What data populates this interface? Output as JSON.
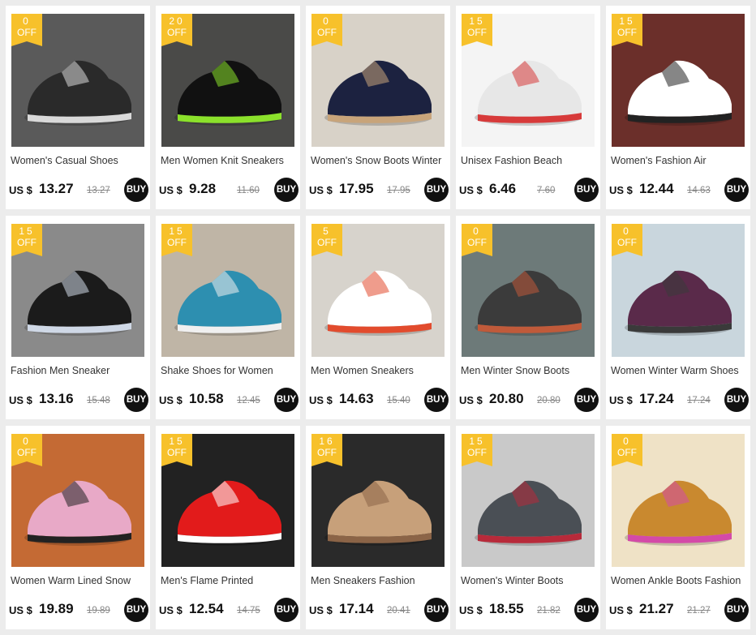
{
  "products": [
    {
      "title": "Women's Casual Shoes",
      "discount": "0",
      "off": "OFF",
      "currency": "US $",
      "price": "13.27",
      "original": "13.27",
      "buy": "BUY",
      "palette": [
        "#5a5a5a",
        "#2a2a2a",
        "#d9d9d9"
      ]
    },
    {
      "title": "Men Women Knit Sneakers",
      "discount": "20",
      "off": "OFF",
      "currency": "US $",
      "price": "9.28",
      "original": "11.60",
      "buy": "BUY",
      "palette": [
        "#4a4a48",
        "#111111",
        "#8be12b"
      ]
    },
    {
      "title": "Women's Snow Boots Winter",
      "discount": "0",
      "off": "OFF",
      "currency": "US $",
      "price": "17.95",
      "original": "17.95",
      "buy": "BUY",
      "palette": [
        "#d8d2c8",
        "#1c2240",
        "#c8a47a"
      ]
    },
    {
      "title": "Unisex Fashion Beach",
      "discount": "15",
      "off": "OFF",
      "currency": "US $",
      "price": "6.46",
      "original": "7.60",
      "buy": "BUY",
      "palette": [
        "#f4f4f4",
        "#e7e7e7",
        "#d73a3a"
      ]
    },
    {
      "title": "Women's Fashion Air",
      "discount": "15",
      "off": "OFF",
      "currency": "US $",
      "price": "12.44",
      "original": "14.63",
      "buy": "BUY",
      "palette": [
        "#6b2f2a",
        "#ffffff",
        "#222222"
      ]
    },
    {
      "title": "Fashion Men Sneaker",
      "discount": "15",
      "off": "OFF",
      "currency": "US $",
      "price": "13.16",
      "original": "15.48",
      "buy": "BUY",
      "palette": [
        "#8a8a8a",
        "#1b1b1b",
        "#cfd8e6"
      ]
    },
    {
      "title": "Shake Shoes for Women",
      "discount": "15",
      "off": "OFF",
      "currency": "US $",
      "price": "10.58",
      "original": "12.45",
      "buy": "BUY",
      "palette": [
        "#bfb5a6",
        "#2d8fb0",
        "#f0f0f0"
      ]
    },
    {
      "title": "Men Women Sneakers",
      "discount": "5",
      "off": "OFF",
      "currency": "US $",
      "price": "14.63",
      "original": "15.40",
      "buy": "BUY",
      "palette": [
        "#d7d3cc",
        "#ffffff",
        "#e24b2d"
      ]
    },
    {
      "title": "Men Winter Snow Boots",
      "discount": "0",
      "off": "OFF",
      "currency": "US $",
      "price": "20.80",
      "original": "20.80",
      "buy": "BUY",
      "palette": [
        "#6d7a79",
        "#3b3b3b",
        "#c05a3a"
      ]
    },
    {
      "title": "Women Winter Warm Shoes",
      "discount": "0",
      "off": "OFF",
      "currency": "US $",
      "price": "17.24",
      "original": "17.24",
      "buy": "BUY",
      "palette": [
        "#c9d6dd",
        "#5a2a4a",
        "#3a3a3a"
      ]
    },
    {
      "title": "Women Warm Lined Snow",
      "discount": "0",
      "off": "OFF",
      "currency": "US $",
      "price": "19.89",
      "original": "19.89",
      "buy": "BUY",
      "palette": [
        "#c46a34",
        "#e8a9c7",
        "#222222"
      ]
    },
    {
      "title": "Men's Flame Printed",
      "discount": "15",
      "off": "OFF",
      "currency": "US $",
      "price": "12.54",
      "original": "14.75",
      "buy": "BUY",
      "palette": [
        "#222222",
        "#e21b1b",
        "#ffffff"
      ]
    },
    {
      "title": "Men Sneakers Fashion",
      "discount": "16",
      "off": "OFF",
      "currency": "US $",
      "price": "17.14",
      "original": "20.41",
      "buy": "BUY",
      "palette": [
        "#2a2a2a",
        "#c7a07a",
        "#8b6447"
      ]
    },
    {
      "title": "Women's Winter Boots",
      "discount": "15",
      "off": "OFF",
      "currency": "US $",
      "price": "18.55",
      "original": "21.82",
      "buy": "BUY",
      "palette": [
        "#c9c9c9",
        "#4a4f55",
        "#b82a3a"
      ]
    },
    {
      "title": "Women Ankle Boots Fashion",
      "discount": "0",
      "off": "OFF",
      "currency": "US $",
      "price": "21.27",
      "original": "21.27",
      "buy": "BUY",
      "palette": [
        "#efe2c6",
        "#c9892f",
        "#d44aa8"
      ]
    }
  ]
}
